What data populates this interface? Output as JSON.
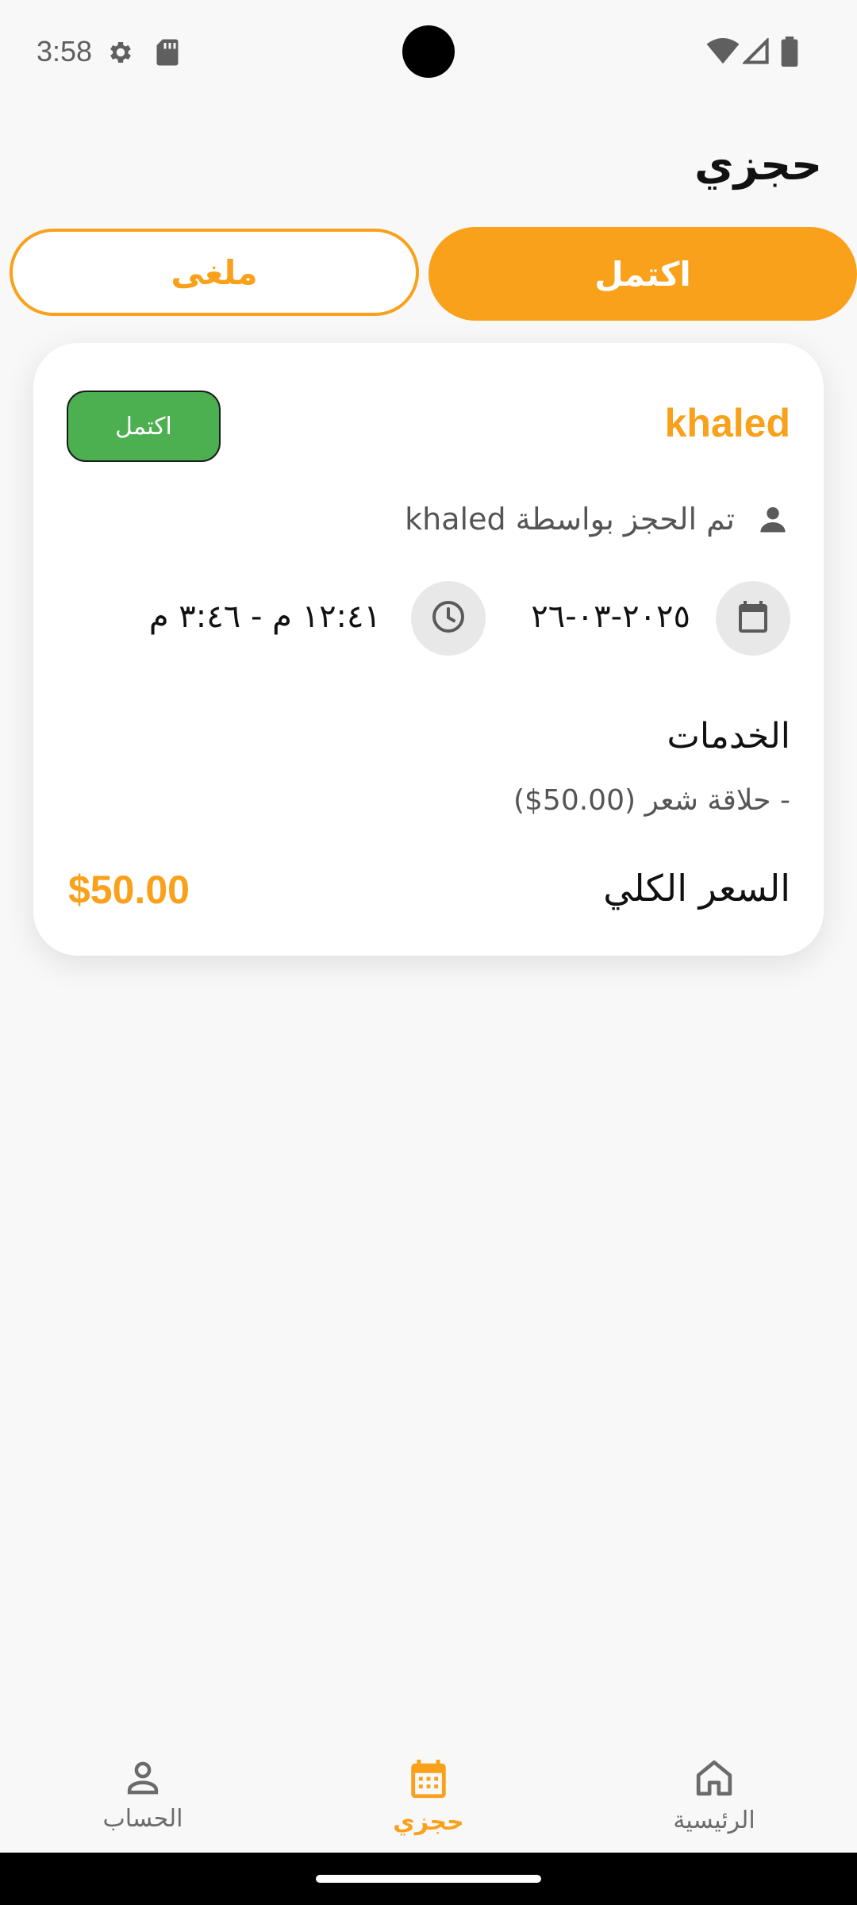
{
  "status_bar": {
    "time": "3:58"
  },
  "header": {
    "title": "حجزي"
  },
  "tabs": [
    {
      "label": "اكتمل",
      "active": true
    },
    {
      "label": "ملغى",
      "active": false
    }
  ],
  "booking": {
    "customer_name": "khaled",
    "status": "اكتمل",
    "booked_by": "تم الحجز بواسطة khaled",
    "date": "٢٠٢٥-٠٣-٢٦",
    "time_range": "١٢:٤١ م - ٣:٤٦ م",
    "services_heading": "الخدمات",
    "services": [
      "- حلاقة شعر (50.00$)"
    ],
    "total_label": "السعر الكلي",
    "total_value": "$50.00"
  },
  "bottom_nav": {
    "account": "الحساب",
    "bookings": "حجزي",
    "home": "الرئيسية"
  },
  "colors": {
    "accent": "#f9a11b",
    "success": "#4caf50",
    "background": "#f8f8f8"
  }
}
